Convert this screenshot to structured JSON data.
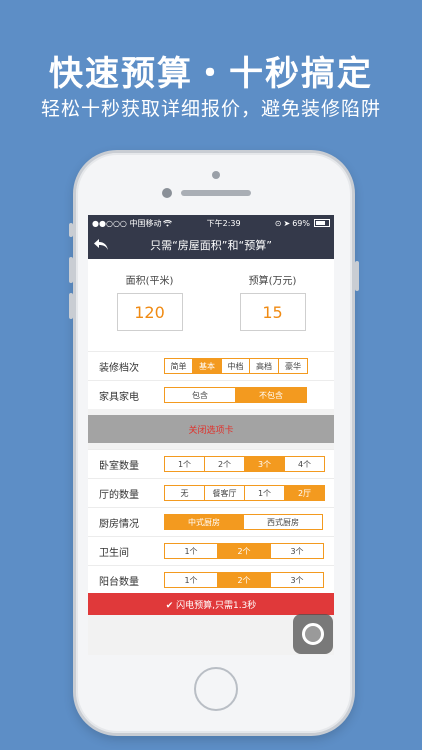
{
  "promo": {
    "headline": "快速预算・十秒搞定",
    "subline": "轻松十秒获取详细报价，避免装修陷阱"
  },
  "status": {
    "carrier": "●●○○○ 中国移动",
    "wifi_icon": "wifi-icon",
    "time": "下午2:39",
    "battery": "69%"
  },
  "nav": {
    "title": "只需“房屋面积”和“预算”"
  },
  "area": {
    "label": "面积(平米)",
    "value": "120"
  },
  "budget": {
    "label": "预算(万元)",
    "value": "15"
  },
  "grade": {
    "label": "装修档次",
    "options": [
      "简单",
      "基本",
      "中档",
      "高档",
      "豪华"
    ],
    "selected": 1
  },
  "furniture": {
    "label": "家具家电",
    "options": [
      "包含",
      "不包含"
    ],
    "selected": 1
  },
  "close_tab": {
    "label": "关闭选项卡"
  },
  "bedrooms": {
    "label": "卧室数量",
    "options": [
      "1个",
      "2个",
      "3个",
      "4个"
    ],
    "selected": 2
  },
  "halls": {
    "label": "厅的数量",
    "options": [
      "无",
      "餐客厅",
      "1个",
      "2厅"
    ],
    "selected": 3
  },
  "kitchen": {
    "label": "厨房情况",
    "options": [
      "中式厨房",
      "西式厨房"
    ],
    "selected": 0
  },
  "bathroom": {
    "label": "卫生间",
    "options": [
      "1个",
      "2个",
      "3个"
    ],
    "selected": 1
  },
  "balcony": {
    "label": "阳台数量",
    "options": [
      "1个",
      "2个",
      "3个"
    ],
    "selected": 1
  },
  "submit": {
    "label": "✔ 闪电预算,只需1.3秒"
  },
  "colors": {
    "background": "#5d8ec6",
    "accent": "#f39a1f",
    "navbar": "#34394a",
    "submit": "#e0393a",
    "close_text": "#e0312b"
  }
}
